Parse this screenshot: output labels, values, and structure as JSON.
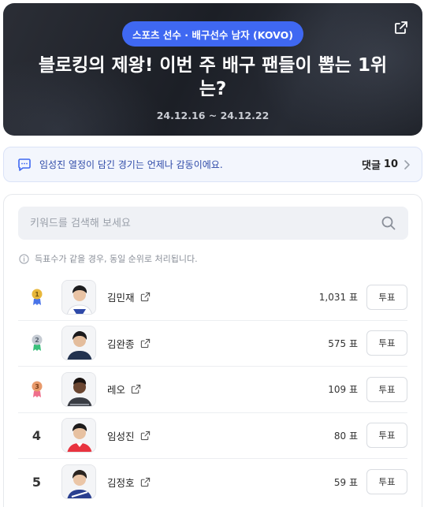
{
  "hero": {
    "badge": "스포츠 선수 · 배구선수 남자 (KOVO)",
    "title": "블로킹의 제왕! 이번 주 배구 팬들이 뽑는 1위는?",
    "date_range": "24.12.16 ~ 24.12.22"
  },
  "comment_bar": {
    "text": "임성진 열정이 담긴 경기는 언제나 감동이에요.",
    "label": "댓글",
    "count": "10"
  },
  "search": {
    "placeholder": "키워드를 검색해 보세요"
  },
  "notice": "득표수가 같을 경우, 동일 순위로 처리됩니다.",
  "rankings": [
    {
      "rank": "1",
      "name": "김민재",
      "votes": "1,031 표",
      "button": "투표",
      "medal": "gold"
    },
    {
      "rank": "2",
      "name": "김완종",
      "votes": "575 표",
      "button": "투표",
      "medal": "silver"
    },
    {
      "rank": "3",
      "name": "레오",
      "votes": "109 표",
      "button": "투표",
      "medal": "bronze"
    },
    {
      "rank": "4",
      "name": "임성진",
      "votes": "80 표",
      "button": "투표"
    },
    {
      "rank": "5",
      "name": "김정호",
      "votes": "59 표",
      "button": "투표"
    }
  ],
  "colors": {
    "accent": "#3f68f2",
    "gold": "#e8b73a",
    "silver": "#c5cbd3",
    "bronze": "#e89a6b",
    "ribbon_blue": "#4a74e8",
    "ribbon_green": "#39c07a",
    "ribbon_pink": "#ef6f8c"
  }
}
